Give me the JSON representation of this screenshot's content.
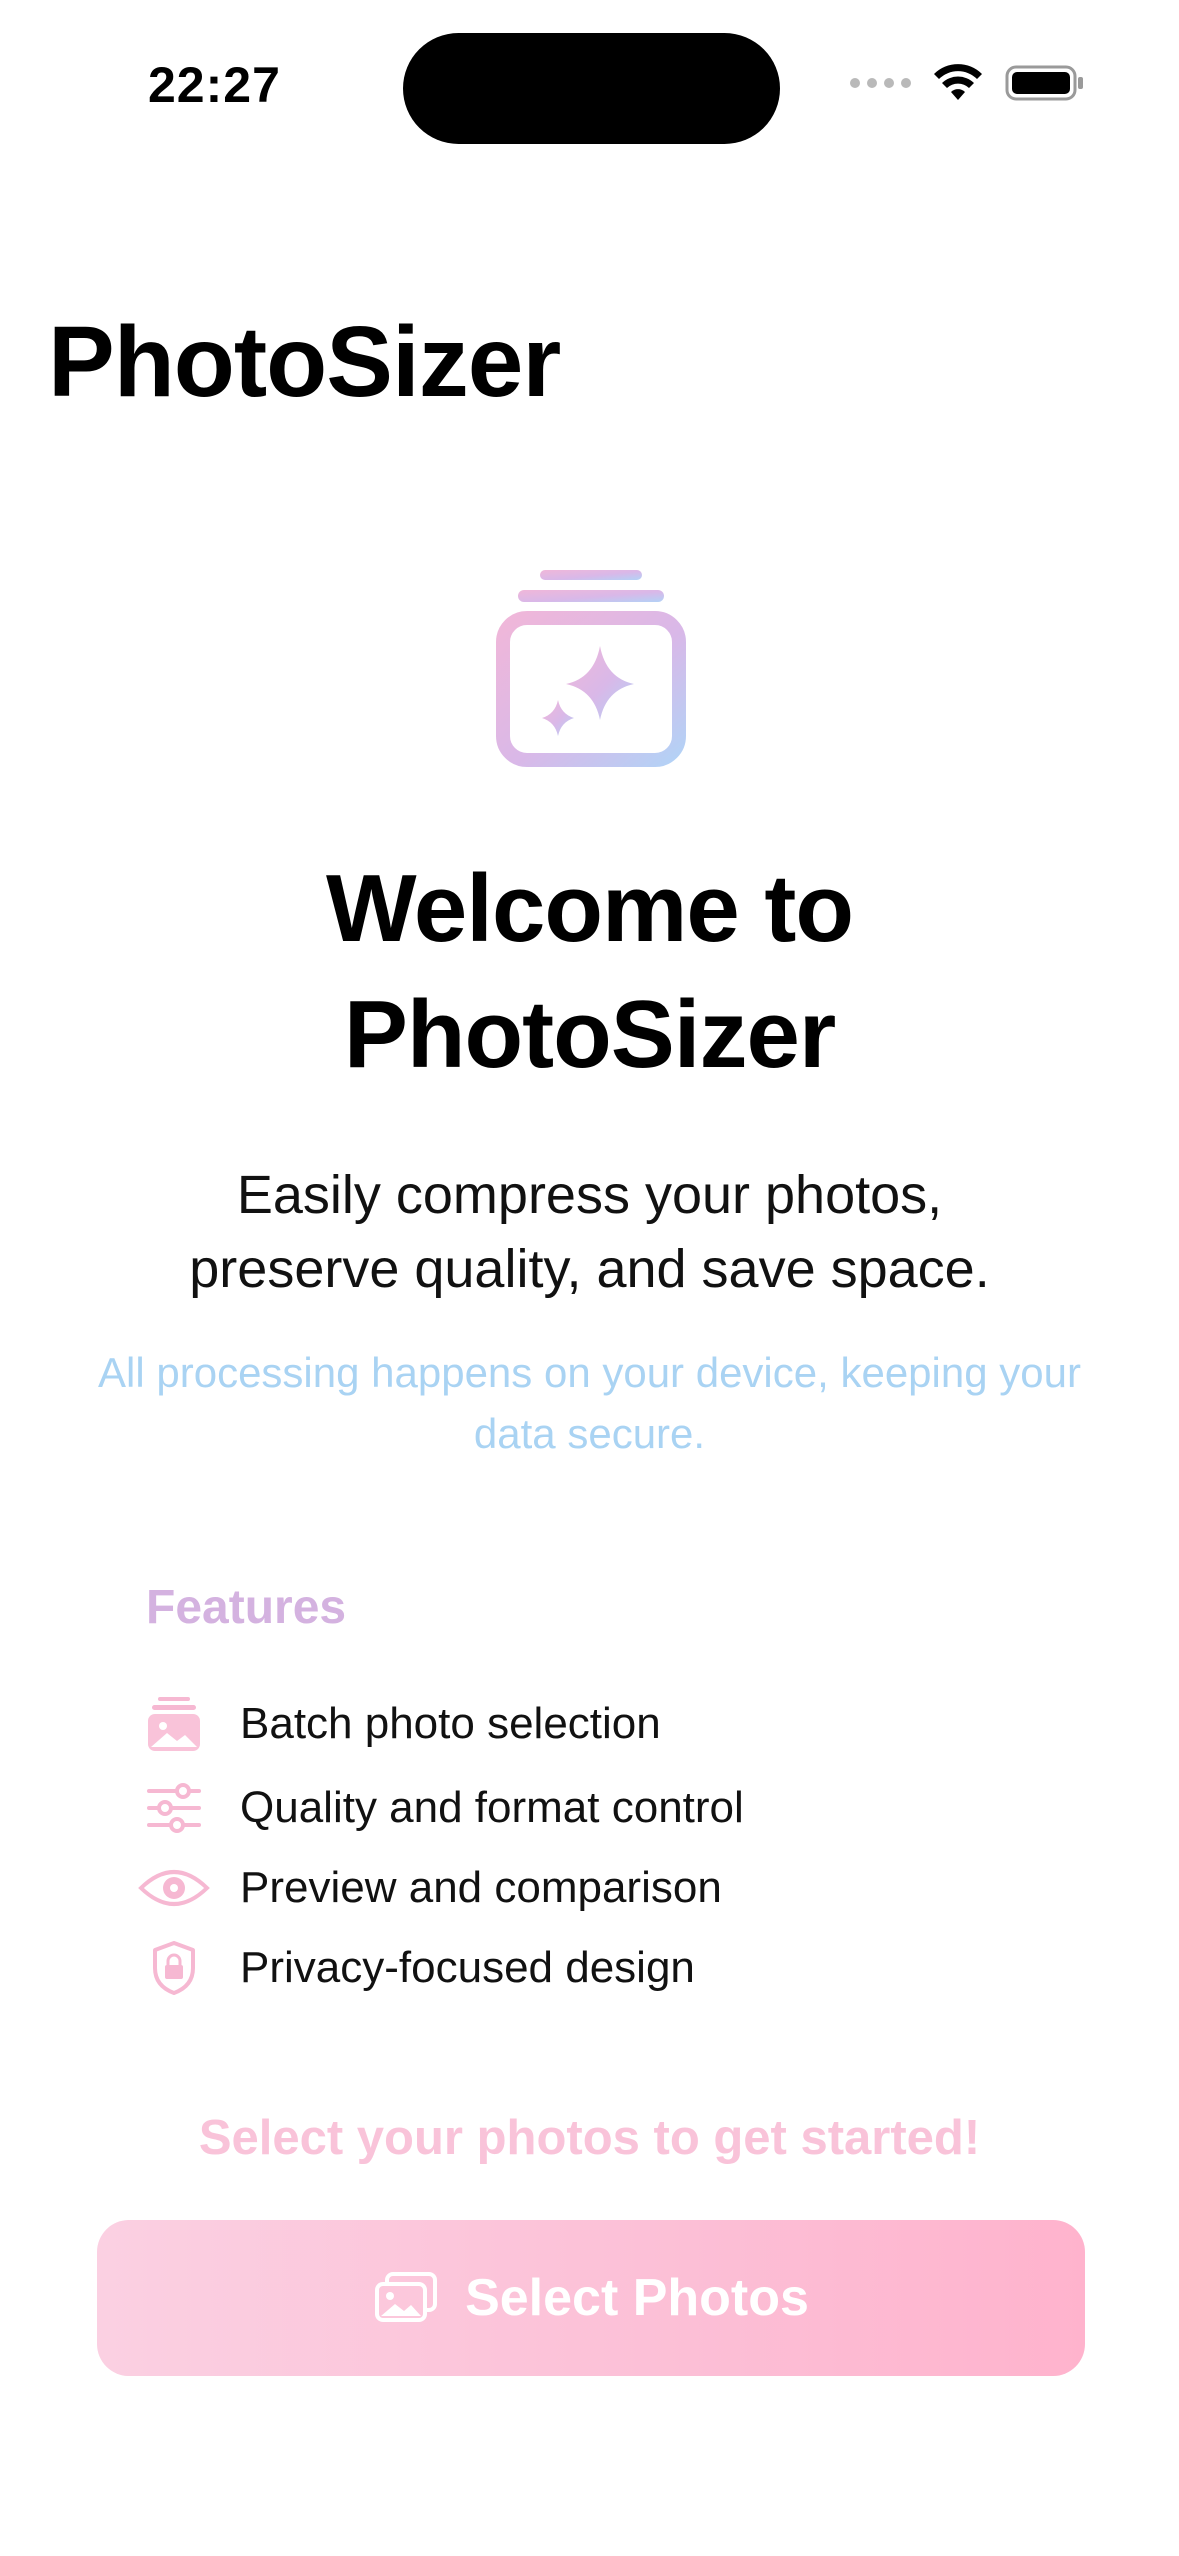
{
  "status_bar": {
    "time": "22:27"
  },
  "app": {
    "title": "PhotoSizer"
  },
  "hero": {
    "icon": "photo-stack-sparkles-icon",
    "welcome_line1": "Welcome to",
    "welcome_line2": "PhotoSizer",
    "subtitle_line1": "Easily compress your photos,",
    "subtitle_line2": "preserve quality, and save space.",
    "privacy_note": "All processing happens on your device, keeping your data secure."
  },
  "features": {
    "heading": "Features",
    "items": [
      {
        "icon": "photo-stack-icon",
        "label": "Batch photo selection"
      },
      {
        "icon": "sliders-icon",
        "label": "Quality and format control"
      },
      {
        "icon": "eye-icon",
        "label": "Preview and comparison"
      },
      {
        "icon": "lock-shield-icon",
        "label": "Privacy-focused design"
      }
    ]
  },
  "cta": {
    "prompt": "Select your photos to get started!",
    "button_label": "Select Photos",
    "button_icon": "photos-icon"
  },
  "colors": {
    "accent_pink": "#f9c3d9",
    "accent_purple": "#d4b2e0",
    "accent_blue": "#a9d3f3"
  }
}
